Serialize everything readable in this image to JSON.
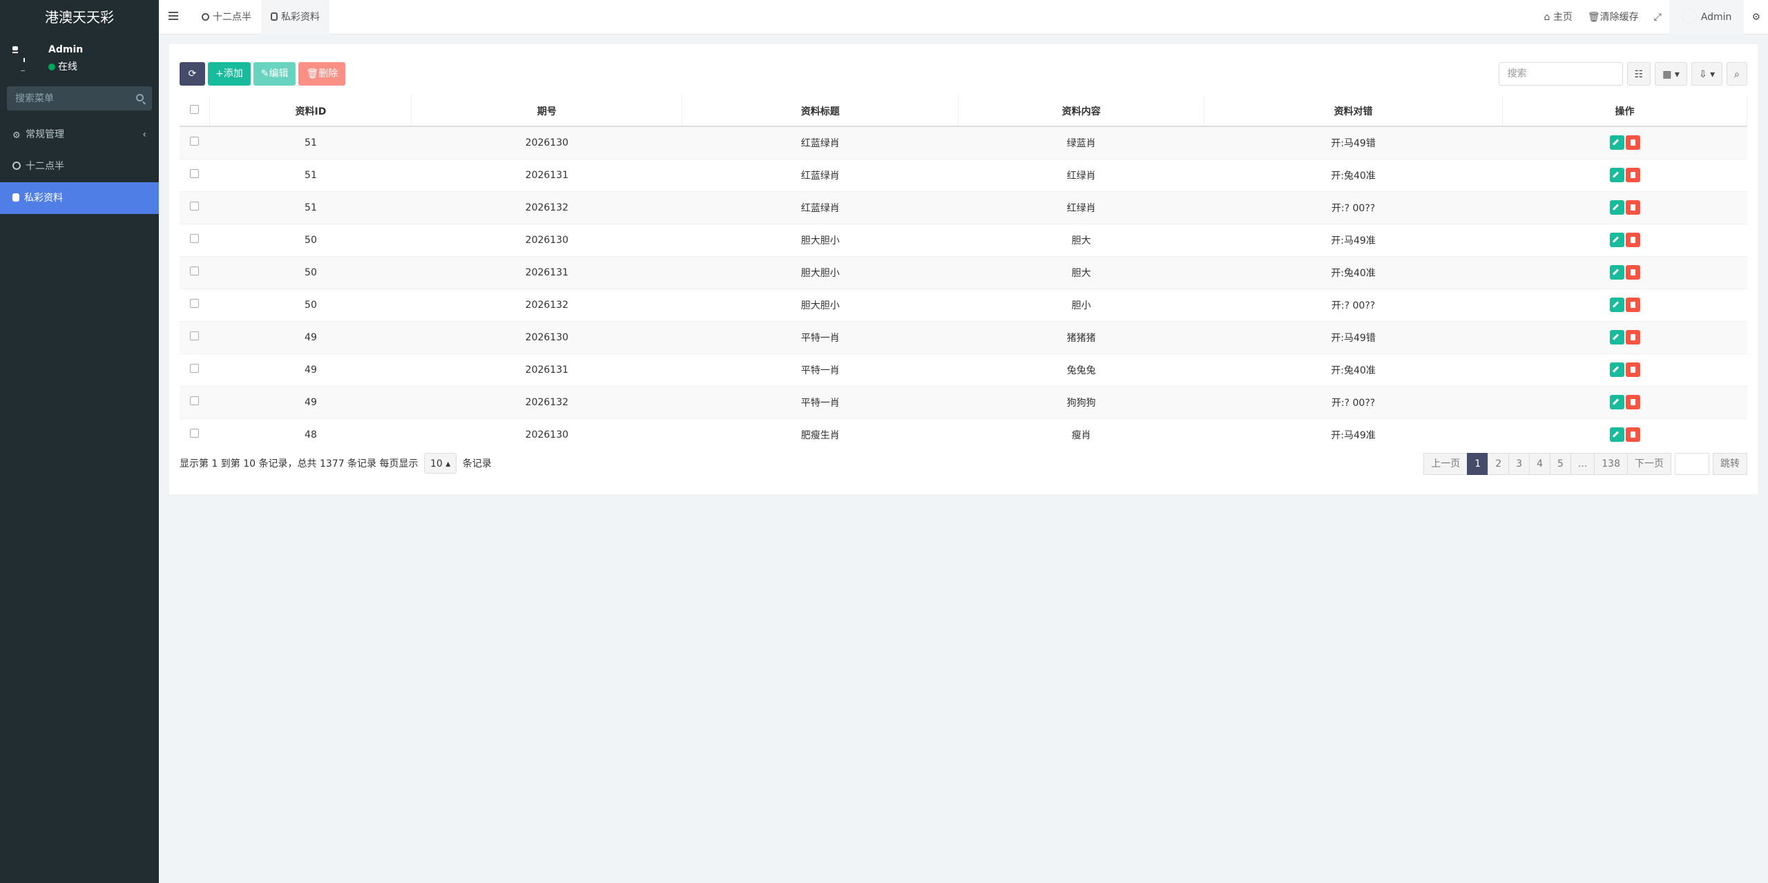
{
  "app": {
    "title": "港澳天天彩"
  },
  "user": {
    "name": "Admin",
    "status": "在线"
  },
  "sidebar": {
    "search_placeholder": "搜索菜单",
    "items": [
      {
        "label": "常规管理"
      },
      {
        "label": "十二点半"
      },
      {
        "label": "私彩资料"
      }
    ]
  },
  "header": {
    "tabs": [
      {
        "label": "十二点半"
      },
      {
        "label": "私彩资料"
      }
    ],
    "home": "主页",
    "clear_cache": "清除缓存",
    "user": "Admin"
  },
  "toolbar": {
    "add": "添加",
    "edit": "编辑",
    "delete": "删除",
    "search_placeholder": "搜索"
  },
  "table": {
    "columns": [
      "资料ID",
      "期号",
      "资料标题",
      "资料内容",
      "资料对错",
      "操作"
    ],
    "rows": [
      [
        "51",
        "2026130",
        "红蓝绿肖",
        "绿蓝肖",
        "开:马49错"
      ],
      [
        "51",
        "2026131",
        "红蓝绿肖",
        "红绿肖",
        "开:兔40准"
      ],
      [
        "51",
        "2026132",
        "红蓝绿肖",
        "红绿肖",
        "开:?  00??"
      ],
      [
        "50",
        "2026130",
        "胆大胆小",
        "胆大",
        "开:马49准"
      ],
      [
        "50",
        "2026131",
        "胆大胆小",
        "胆大",
        "开:兔40准"
      ],
      [
        "50",
        "2026132",
        "胆大胆小",
        "胆小",
        "开:?  00??"
      ],
      [
        "49",
        "2026130",
        "平特一肖",
        "猪猪猪",
        "开:马49错"
      ],
      [
        "49",
        "2026131",
        "平特一肖",
        "兔兔兔",
        "开:兔40准"
      ],
      [
        "49",
        "2026132",
        "平特一肖",
        "狗狗狗",
        "开:?  00??"
      ],
      [
        "48",
        "2026130",
        "肥瘦生肖",
        "瘦肖",
        "开:马49准"
      ]
    ]
  },
  "footer": {
    "info_prefix": "显示第 1 到第 10 条记录，总共 1377 条记录 每页显示",
    "page_size": "10",
    "info_suffix": "条记录"
  },
  "pagination": {
    "prev": "上一页",
    "pages": [
      "1",
      "2",
      "3",
      "4",
      "5",
      "...",
      "138"
    ],
    "next": "下一页",
    "jump": "跳转"
  }
}
